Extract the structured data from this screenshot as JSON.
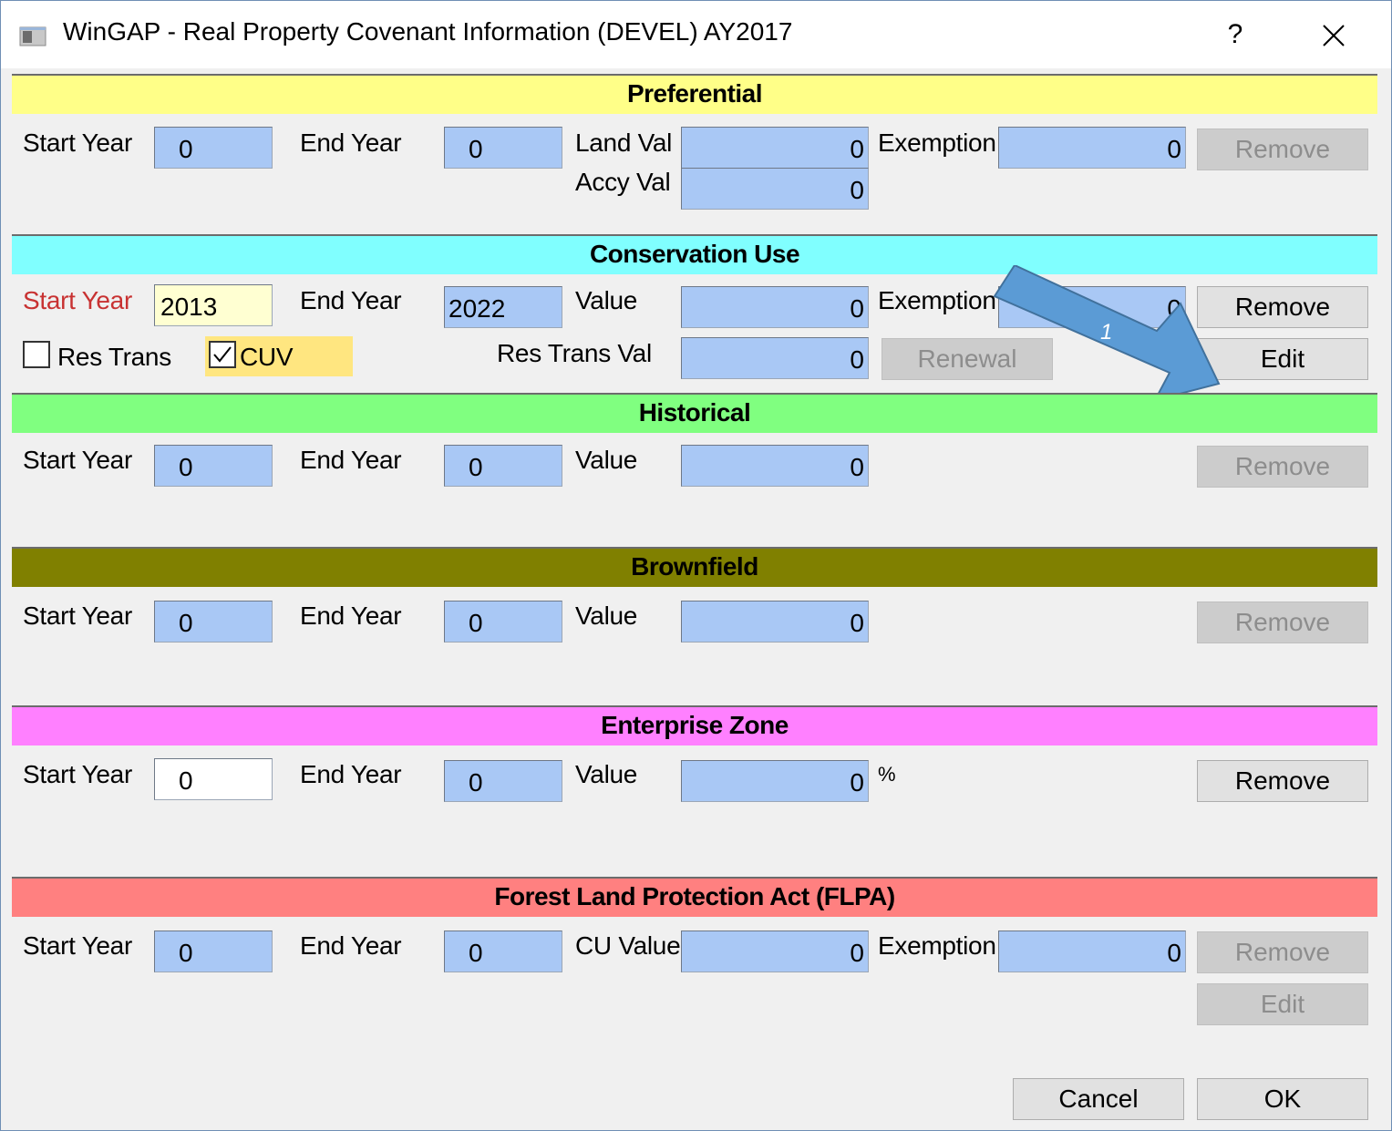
{
  "window": {
    "title": "WinGAP - Real Property Covenant Information (DEVEL) AY2017",
    "help_label": "?",
    "close_icon": "close-x-icon"
  },
  "colors": {
    "preferential": "#ffff88",
    "conservation": "#80ffff",
    "historical": "#80ff80",
    "brownfield": "#808000",
    "enterprise": "#ff80ff",
    "flpa": "#ff8080",
    "field_blue": "#a9c8f5",
    "arrow": "#5b9bd5"
  },
  "preferential": {
    "header": "Preferential",
    "start_year_label": "Start Year",
    "start_year": "0",
    "end_year_label": "End Year",
    "end_year": "0",
    "land_val_label": "Land Val",
    "land_val": "0",
    "accy_val_label": "Accy Val",
    "accy_val": "0",
    "exemption_label": "Exemption",
    "exemption": "0",
    "remove_label": "Remove"
  },
  "conservation": {
    "header": "Conservation Use",
    "start_year_label": "Start Year",
    "start_year": "2013",
    "end_year_label": "End Year",
    "end_year": "2022",
    "value_label": "Value",
    "value": "0",
    "exemption_label": "Exemption",
    "exemption": "0",
    "remove_label": "Remove",
    "res_trans_label": "Res Trans",
    "cuv_label": "CUV",
    "res_trans_val_label": "Res Trans Val",
    "res_trans_val": "0",
    "renewal_label": "Renewal",
    "edit_label": "Edit",
    "callout_number": "1"
  },
  "historical": {
    "header": "Historical",
    "start_year_label": "Start Year",
    "start_year": "0",
    "end_year_label": "End Year",
    "end_year": "0",
    "value_label": "Value",
    "value": "0",
    "remove_label": "Remove"
  },
  "brownfield": {
    "header": "Brownfield",
    "start_year_label": "Start Year",
    "start_year": "0",
    "end_year_label": "End Year",
    "end_year": "0",
    "value_label": "Value",
    "value": "0",
    "remove_label": "Remove"
  },
  "enterprise": {
    "header": "Enterprise Zone",
    "start_year_label": "Start Year",
    "start_year": "0",
    "end_year_label": "End Year",
    "end_year": "0",
    "value_label": "Value",
    "value": "0",
    "percent_label": "%",
    "remove_label": "Remove"
  },
  "flpa": {
    "header": "Forest Land Protection Act (FLPA)",
    "start_year_label": "Start Year",
    "start_year": "0",
    "end_year_label": "End Year",
    "end_year": "0",
    "cu_value_label": "CU Value",
    "cu_value": "0",
    "exemption_label": "Exemption",
    "exemption": "0",
    "remove_label": "Remove",
    "edit_label": "Edit"
  },
  "footer": {
    "cancel_label": "Cancel",
    "ok_label": "OK"
  }
}
